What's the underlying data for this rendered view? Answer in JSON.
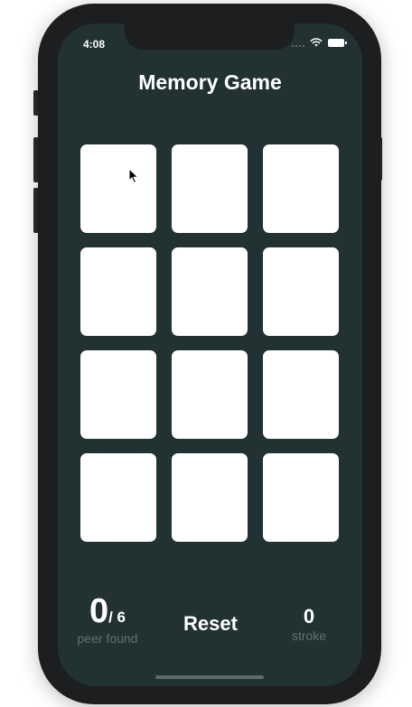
{
  "status_bar": {
    "time": "4:08",
    "icons": [
      "signal-icon",
      "wifi-icon",
      "battery-icon"
    ]
  },
  "game": {
    "title": "Memory Game",
    "cards": [
      {
        "state": "face-down"
      },
      {
        "state": "face-down"
      },
      {
        "state": "face-down"
      },
      {
        "state": "face-down"
      },
      {
        "state": "face-down"
      },
      {
        "state": "face-down"
      },
      {
        "state": "face-down"
      },
      {
        "state": "face-down"
      },
      {
        "state": "face-down"
      },
      {
        "state": "face-down"
      },
      {
        "state": "face-down"
      },
      {
        "state": "face-down"
      }
    ]
  },
  "footer": {
    "found_count": "0",
    "found_total": "/ 6",
    "found_label": "peer found",
    "reset_label": "Reset",
    "stroke_count": "0",
    "stroke_label": "stroke"
  },
  "colors": {
    "background": "#223233",
    "card": "#ffffff",
    "muted_text": "#627071",
    "device_frame": "#1c1e1f"
  }
}
